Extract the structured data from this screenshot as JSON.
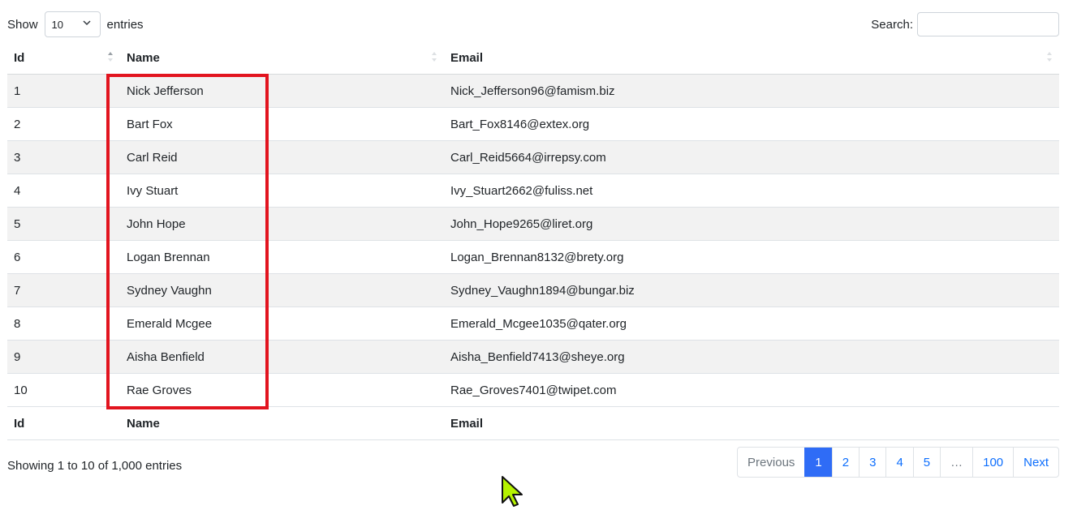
{
  "controls": {
    "show_label": "Show",
    "entries_label": "entries",
    "page_length_value": "10",
    "search_label": "Search:",
    "search_value": ""
  },
  "table": {
    "headers": [
      "Id",
      "Name",
      "Email"
    ],
    "footers": [
      "Id",
      "Name",
      "Email"
    ],
    "rows": [
      {
        "id": "1",
        "name": "Nick Jefferson",
        "email": "Nick_Jefferson96@famism.biz"
      },
      {
        "id": "2",
        "name": "Bart Fox",
        "email": "Bart_Fox8146@extex.org"
      },
      {
        "id": "3",
        "name": "Carl Reid",
        "email": "Carl_Reid5664@irrepsy.com"
      },
      {
        "id": "4",
        "name": "Ivy Stuart",
        "email": "Ivy_Stuart2662@fuliss.net"
      },
      {
        "id": "5",
        "name": "John Hope",
        "email": "John_Hope9265@liret.org"
      },
      {
        "id": "6",
        "name": "Logan Brennan",
        "email": "Logan_Brennan8132@brety.org"
      },
      {
        "id": "7",
        "name": "Sydney Vaughn",
        "email": "Sydney_Vaughn1894@bungar.biz"
      },
      {
        "id": "8",
        "name": "Emerald Mcgee",
        "email": "Emerald_Mcgee1035@qater.org"
      },
      {
        "id": "9",
        "name": "Aisha Benfield",
        "email": "Aisha_Benfield7413@sheye.org"
      },
      {
        "id": "10",
        "name": "Rae Groves",
        "email": "Rae_Groves7401@twipet.com"
      }
    ]
  },
  "info": "Showing 1 to 10 of 1,000 entries",
  "pagination": {
    "previous": "Previous",
    "pages": [
      "1",
      "2",
      "3",
      "4",
      "5",
      "…",
      "100"
    ],
    "next": "Next",
    "current": "1"
  },
  "colors": {
    "highlight": "#e2141f",
    "active_page": "#2f6cf6",
    "link": "#0d6efd"
  }
}
